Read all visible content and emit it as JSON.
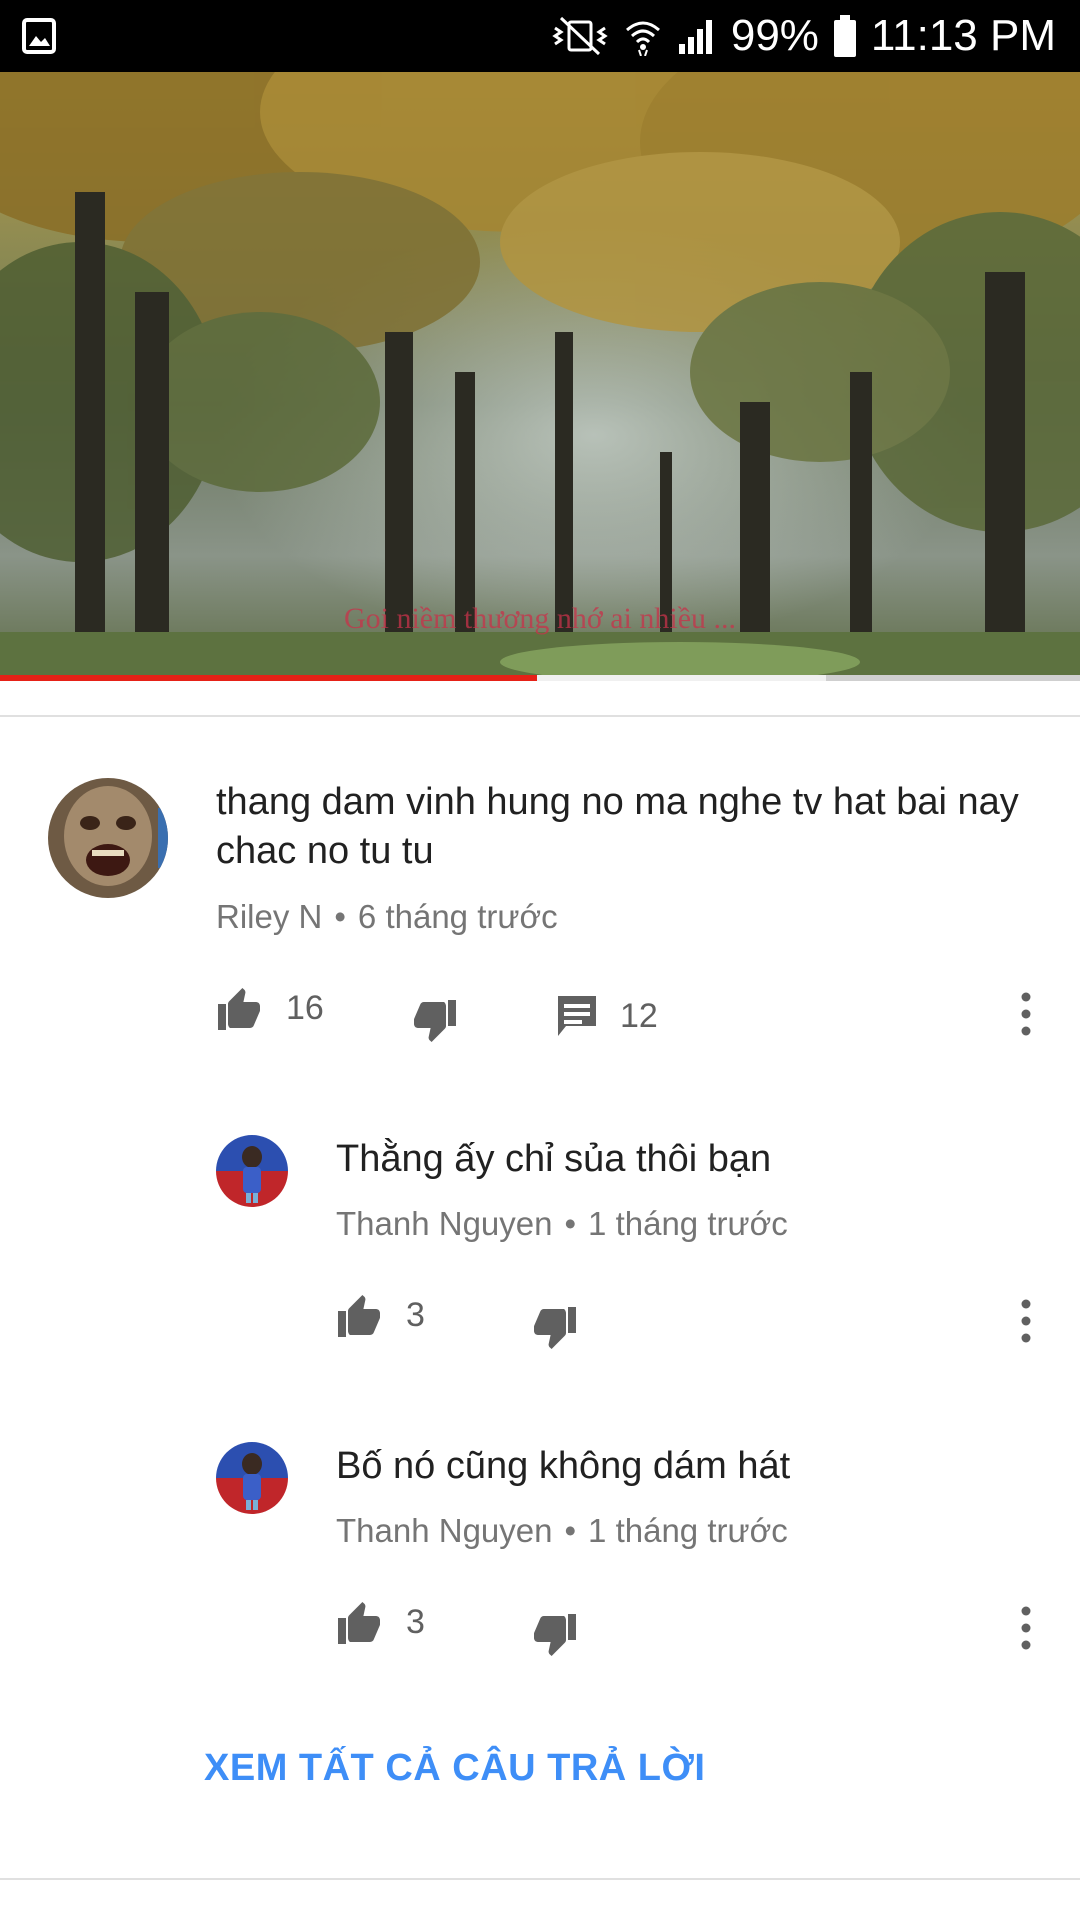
{
  "status_bar": {
    "battery": "99%",
    "time": "11:13 PM",
    "icons": [
      "gallery-icon",
      "vibrate-mute-icon",
      "wifi-icon",
      "signal-icon",
      "battery-icon"
    ]
  },
  "video": {
    "caption": "Goi niềm thương nhớ ai nhiều ...",
    "progress": 0.497,
    "buffered": 0.765
  },
  "comment": {
    "text": "thang dam vinh hung no ma nghe tv  hat bai nay chac no tu tu",
    "author": "Riley N",
    "separator": "•",
    "time": "6 tháng trước",
    "likes": "16",
    "replies": "12"
  },
  "replies": [
    {
      "text": "Thằng ấy chỉ sủa thôi bạn",
      "author": "Thanh Nguyen",
      "separator": "•",
      "time": "1 tháng trước",
      "likes": "3"
    },
    {
      "text": "Bố nó cũng không dám hát",
      "author": "Thanh Nguyen",
      "separator": "•",
      "time": "1 tháng trước",
      "likes": "3"
    }
  ],
  "see_all_label": "XEM TẤT CẢ CÂU TRẢ LỜI",
  "colors": {
    "accent_link": "#3e8ef7",
    "progress": "#e62117",
    "meta_text": "#757575"
  }
}
